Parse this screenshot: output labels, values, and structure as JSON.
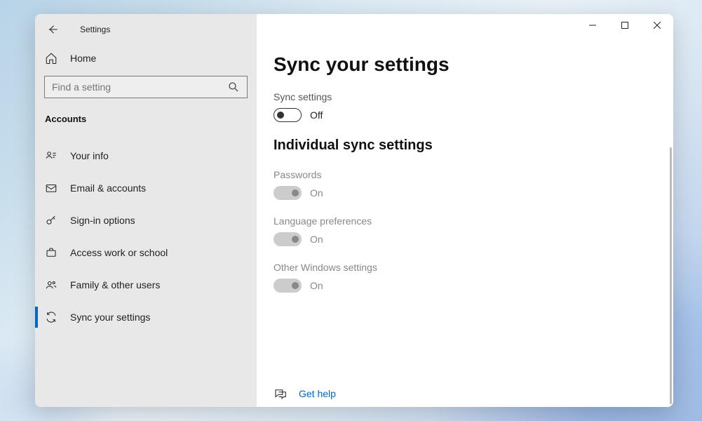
{
  "app": {
    "title": "Settings"
  },
  "sidebar": {
    "home_label": "Home",
    "search_placeholder": "Find a setting",
    "section": "Accounts",
    "items": [
      {
        "label": "Your info"
      },
      {
        "label": "Email & accounts"
      },
      {
        "label": "Sign-in options"
      },
      {
        "label": "Access work or school"
      },
      {
        "label": "Family & other users"
      },
      {
        "label": "Sync your settings"
      }
    ]
  },
  "page": {
    "title": "Sync your settings",
    "sync_label": "Sync settings",
    "sync_state": "Off",
    "sub_title": "Individual sync settings",
    "items": [
      {
        "label": "Passwords",
        "state": "On"
      },
      {
        "label": "Language preferences",
        "state": "On"
      },
      {
        "label": "Other Windows settings",
        "state": "On"
      }
    ],
    "help_label": "Get help"
  }
}
